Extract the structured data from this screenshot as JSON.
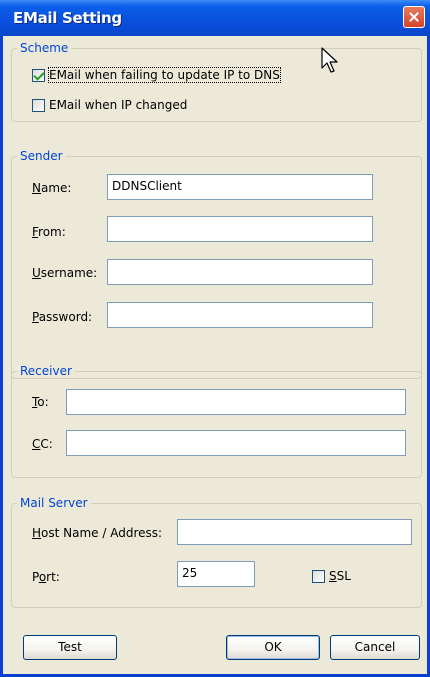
{
  "window": {
    "title": "EMail Setting",
    "close_icon": "close-icon"
  },
  "scheme": {
    "legend": "Scheme",
    "options": [
      {
        "label": "EMail when failing to update IP to DNS",
        "checked": true
      },
      {
        "label": "EMail when IP changed",
        "checked": false
      }
    ]
  },
  "sender": {
    "legend": "Sender",
    "name": {
      "label_accel": "N",
      "label_rest": "ame:",
      "value": "DDNSClient"
    },
    "from": {
      "label_accel": "F",
      "label_rest": "rom:",
      "value": ""
    },
    "username": {
      "label_accel": "U",
      "label_rest": "sername:",
      "value": ""
    },
    "password": {
      "label_accel": "P",
      "label_rest": "assword:",
      "value": ""
    }
  },
  "receiver": {
    "legend": "Receiver",
    "to": {
      "label_accel": "T",
      "label_rest": "o:",
      "value": ""
    },
    "cc": {
      "label_accel": "C",
      "label_rest": "C:",
      "value": ""
    }
  },
  "mail_server": {
    "legend": "Mail Server",
    "host": {
      "label_accel": "H",
      "label_rest": "ost Name / Address:",
      "value": ""
    },
    "port": {
      "label_pre": "P",
      "label_accel": "o",
      "label_rest": "rt:",
      "value": "25"
    },
    "ssl": {
      "label_accel": "S",
      "label_rest": "SL",
      "checked": false
    }
  },
  "buttons": {
    "test": "Test",
    "ok": "OK",
    "cancel": "Cancel"
  }
}
